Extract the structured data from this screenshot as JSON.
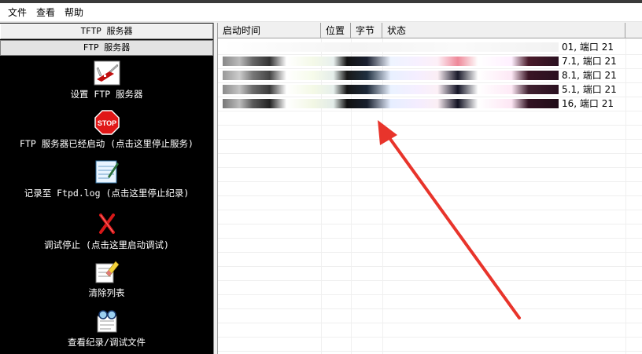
{
  "menu": {
    "file": "文件",
    "view": "查看",
    "help": "帮助"
  },
  "sidebar": {
    "tftp_button": "TFTP 服务器",
    "ftp_button": "FTP 服务器",
    "tools": [
      {
        "label": "设置 FTP 服务器",
        "icon": "swiss-knife-icon"
      },
      {
        "label": "FTP 服务器已经启动 (点击这里停止服务)",
        "icon": "stop-sign-icon",
        "stop_text": "STOP"
      },
      {
        "label": "记录至 Ftpd.log (点击这里停止纪录)",
        "icon": "log-notepad-icon"
      },
      {
        "label": "调试停止 (点击这里启动调试)",
        "icon": "debug-x-icon"
      },
      {
        "label": "清除列表",
        "icon": "eraser-icon"
      },
      {
        "label": "查看纪录/调试文件",
        "icon": "view-log-icon"
      }
    ]
  },
  "table": {
    "columns": {
      "time": "启动时间",
      "position": "位置",
      "bytes": "字节",
      "status": "状态"
    },
    "rows": [
      {
        "tail": "01, 端口 21"
      },
      {
        "tail": "7.1, 端口 21"
      },
      {
        "tail": "8.1, 端口 21"
      },
      {
        "tail": "5.1, 端口 21"
      },
      {
        "tail": "16, 端口 21"
      }
    ]
  },
  "colors": {
    "sidebar_bg": "#000000",
    "annotation_arrow": "#e8342b",
    "stop_red": "#e01818"
  }
}
